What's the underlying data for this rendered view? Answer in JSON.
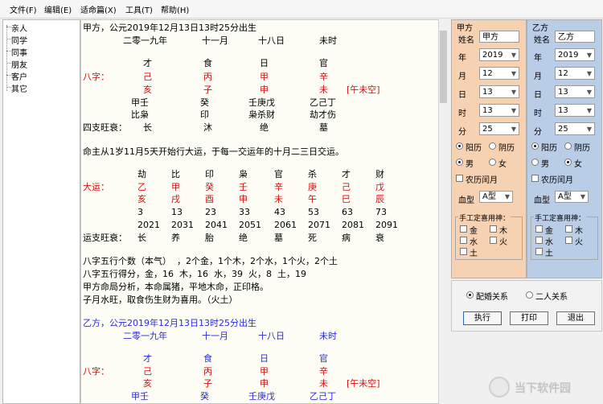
{
  "menubar": {
    "items": [
      "文件(F)",
      "编辑(E)",
      "适命篇(X)",
      "工具(T)",
      "帮助(H)"
    ]
  },
  "sidebar": {
    "items": [
      "亲人",
      "同学",
      "同事",
      "朋友",
      "客户",
      "其它"
    ]
  },
  "report": {
    "a_title": "甲方，公元2019年12月13日13时25分出生",
    "a_date_cn": [
      "二零一九年",
      "十一月",
      "十八日",
      "未时"
    ],
    "shishen_top": [
      "才",
      "食",
      "日",
      "官"
    ],
    "bazi_label": "八字：",
    "stems": [
      "己",
      "丙",
      "甲",
      "辛"
    ],
    "branches": [
      "亥",
      "子",
      "申",
      "未"
    ],
    "kongwang": "[午未空]",
    "hidden_stems": [
      "甲壬",
      "癸",
      "壬庚戊",
      "乙己丁"
    ],
    "hidden_gods": [
      "比枭",
      "印",
      "枭杀财",
      "劫才伤"
    ],
    "sizhi_label": "四支旺衰：",
    "sizhi_values": [
      "长",
      "沐",
      "绝",
      "墓"
    ],
    "dayun_note": "命主从1岁11月5天开始行大运，于每一交运年的十月二三日交运。",
    "dayun_gods": [
      "劫",
      "比",
      "印",
      "枭",
      "官",
      "杀",
      "才",
      "财"
    ],
    "dayun_label": "大运：",
    "dayun_stems": [
      "乙",
      "甲",
      "癸",
      "壬",
      "辛",
      "庚",
      "己",
      "戊"
    ],
    "dayun_branches": [
      "亥",
      "戌",
      "酉",
      "申",
      "未",
      "午",
      "巳",
      "辰"
    ],
    "dayun_ages": [
      "3",
      "13",
      "23",
      "33",
      "43",
      "53",
      "63",
      "73"
    ],
    "dayun_years": [
      "2021",
      "2031",
      "2041",
      "2051",
      "2061",
      "2071",
      "2081",
      "2091"
    ],
    "yunzhi_label": "运支旺衰：",
    "yunzhi_values": [
      "长",
      "养",
      "胎",
      "绝",
      "墓",
      "死",
      "病",
      "衰"
    ],
    "wuxing_count": "八字五行个数（本气）  ，2个金，1个木，2个水，1个火，2个土",
    "wuxing_score": "八字五行得分，金，16  木，16  水，39  火，8  土，19",
    "mingju": "甲方命局分析，本命属猪，平地木命，正印格。",
    "yongshen": "子月水旺，取食伤生财为喜用。（火土）",
    "b_title": "乙方，公元2019年12月13日13时25分出生",
    "b_date_cn": [
      "二零一九年",
      "十一月",
      "十八日",
      "未时"
    ],
    "b_shishen_top": [
      "才",
      "食",
      "日",
      "官"
    ],
    "b_stems": [
      "己",
      "丙",
      "甲",
      "辛"
    ],
    "b_branches": [
      "亥",
      "子",
      "申",
      "未"
    ],
    "b_kongwang": "[午未空]",
    "b_hidden_stems": [
      "甲壬",
      "癸",
      "壬庚戊",
      "乙己丁"
    ]
  },
  "panel_a": {
    "title": "甲方",
    "name_label": "姓名",
    "name_value": "甲方",
    "fields": [
      {
        "label": "年",
        "value": "2019"
      },
      {
        "label": "月",
        "value": "12"
      },
      {
        "label": "日",
        "value": "13"
      },
      {
        "label": "时",
        "value": "13"
      },
      {
        "label": "分",
        "value": "25"
      }
    ],
    "cal_solar": "阳历",
    "cal_lunar": "阴历",
    "calendar_selected": "阳历",
    "sex_male": "男",
    "sex_female": "女",
    "sex_selected": "男",
    "leap_label": "农历闰月",
    "blood_label": "血型",
    "blood_value": "A型",
    "yongshen_title": "手工定喜用神：",
    "elements": [
      "金",
      "木",
      "水",
      "火",
      "土"
    ]
  },
  "panel_b": {
    "title": "乙方",
    "name_label": "姓名",
    "name_value": "乙方",
    "fields": [
      {
        "label": "年",
        "value": "2019"
      },
      {
        "label": "月",
        "value": "12"
      },
      {
        "label": "日",
        "value": "13"
      },
      {
        "label": "时",
        "value": "13"
      },
      {
        "label": "分",
        "value": "25"
      }
    ],
    "cal_solar": "阳历",
    "cal_lunar": "阴历",
    "calendar_selected": "阳历",
    "sex_male": "男",
    "sex_female": "女",
    "sex_selected": "女",
    "leap_label": "农历闰月",
    "blood_label": "血型",
    "blood_value": "A型",
    "yongshen_title": "手工定喜用神：",
    "elements": [
      "金",
      "木",
      "水",
      "火",
      "土"
    ]
  },
  "bottom": {
    "mode_match": "配婚关系",
    "mode_pair": "二人关系",
    "mode_selected": "配婚关系",
    "btn_run": "执行",
    "btn_print": "打印",
    "btn_exit": "退出"
  },
  "watermark": {
    "text": "当下软件园"
  },
  "colors": {
    "blue_text": "#2a2ad8",
    "red_text": "#d21010",
    "panel_a_bg": "#f7d2b2",
    "panel_b_bg": "#b9cde6"
  }
}
